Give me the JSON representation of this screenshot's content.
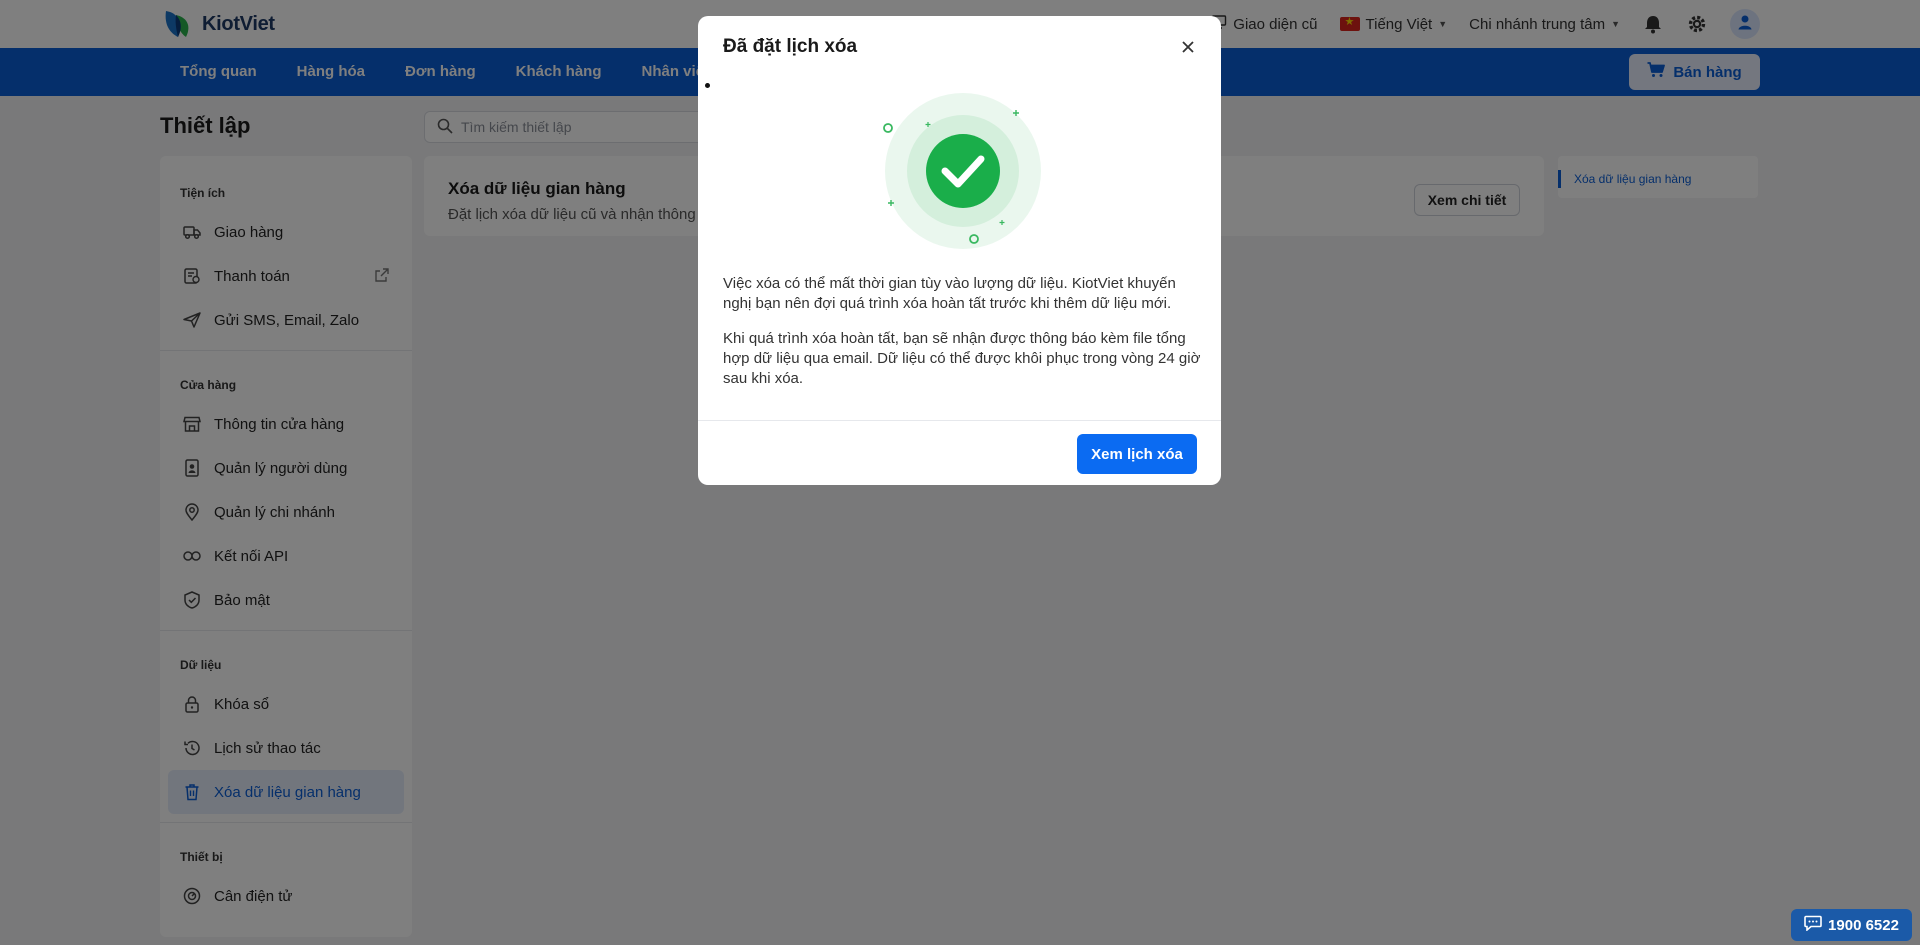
{
  "header": {
    "logo_text": "KiotViet",
    "old_ui_label": "Giao diện cũ",
    "language_label": "Tiếng Việt",
    "branch_label": "Chi nhánh trung tâm",
    "icons": [
      "monitor-icon",
      "bell-icon",
      "gear-icon",
      "user-icon"
    ]
  },
  "nav": {
    "items": [
      {
        "label": "Tổng quan"
      },
      {
        "label": "Hàng hóa"
      },
      {
        "label": "Đơn hàng"
      },
      {
        "label": "Khách hàng"
      },
      {
        "label": "Nhân viên"
      }
    ],
    "sell_label": "Bán hàng"
  },
  "page": {
    "title": "Thiết lập",
    "search_placeholder": "Tìm kiếm thiết lập"
  },
  "sidebar": {
    "groups": [
      {
        "title": "Tiện ích",
        "items": [
          {
            "label": "Giao hàng",
            "icon": "truck-icon"
          },
          {
            "label": "Thanh toán",
            "icon": "payment-icon"
          },
          {
            "label": "Gửi SMS, Email, Zalo",
            "icon": "send-icon"
          }
        ]
      },
      {
        "title": "Cửa hàng",
        "items": [
          {
            "label": "Thông tin cửa hàng",
            "icon": "store-icon"
          },
          {
            "label": "Quản lý người dùng",
            "icon": "user-badge-icon"
          },
          {
            "label": "Quản lý chi nhánh",
            "icon": "location-icon"
          },
          {
            "label": "Kết nối API",
            "icon": "link-icon"
          },
          {
            "label": "Bảo mật",
            "icon": "shield-icon"
          }
        ]
      },
      {
        "title": "Dữ liệu",
        "items": [
          {
            "label": "Khóa sổ",
            "icon": "lock-icon"
          },
          {
            "label": "Lịch sử thao tác",
            "icon": "history-icon"
          },
          {
            "label": "Xóa dữ liệu gian hàng",
            "icon": "trash-icon"
          }
        ]
      },
      {
        "title": "Thiết bị",
        "items": [
          {
            "label": "Cân điện tử",
            "icon": "scale-icon"
          }
        ]
      }
    ],
    "active_item": "Xóa dữ liệu gian hàng"
  },
  "content": {
    "card_title": "Xóa dữ liệu gian hàng",
    "card_desc": "Đặt lịch xóa dữ liệu cũ và nhận thông b",
    "detail_button": "Xem chi tiết"
  },
  "toc": {
    "item": "Xóa dữ liệu gian hàng"
  },
  "modal": {
    "title": "Đã đặt lịch xóa",
    "paragraph_1": "Việc xóa có thể mất thời gian tùy vào lượng dữ liệu. KiotViet khuyến nghị bạn nên đợi quá trình xóa hoàn tất trước khi thêm dữ liệu mới.",
    "paragraph_2": "Khi quá trình xóa hoàn tất, bạn sẽ nhận được thông báo kèm file tổng hợp dữ liệu qua email. Dữ liệu có thể được khôi phục trong vòng 24 giờ sau khi xóa.",
    "primary_button": "Xem lịch xóa",
    "success_color": "#1aae4a"
  },
  "support": {
    "phone": "1900 6522"
  },
  "colors": {
    "brand_blue": "#0b5ed7",
    "button_blue": "#0b6bf2"
  }
}
